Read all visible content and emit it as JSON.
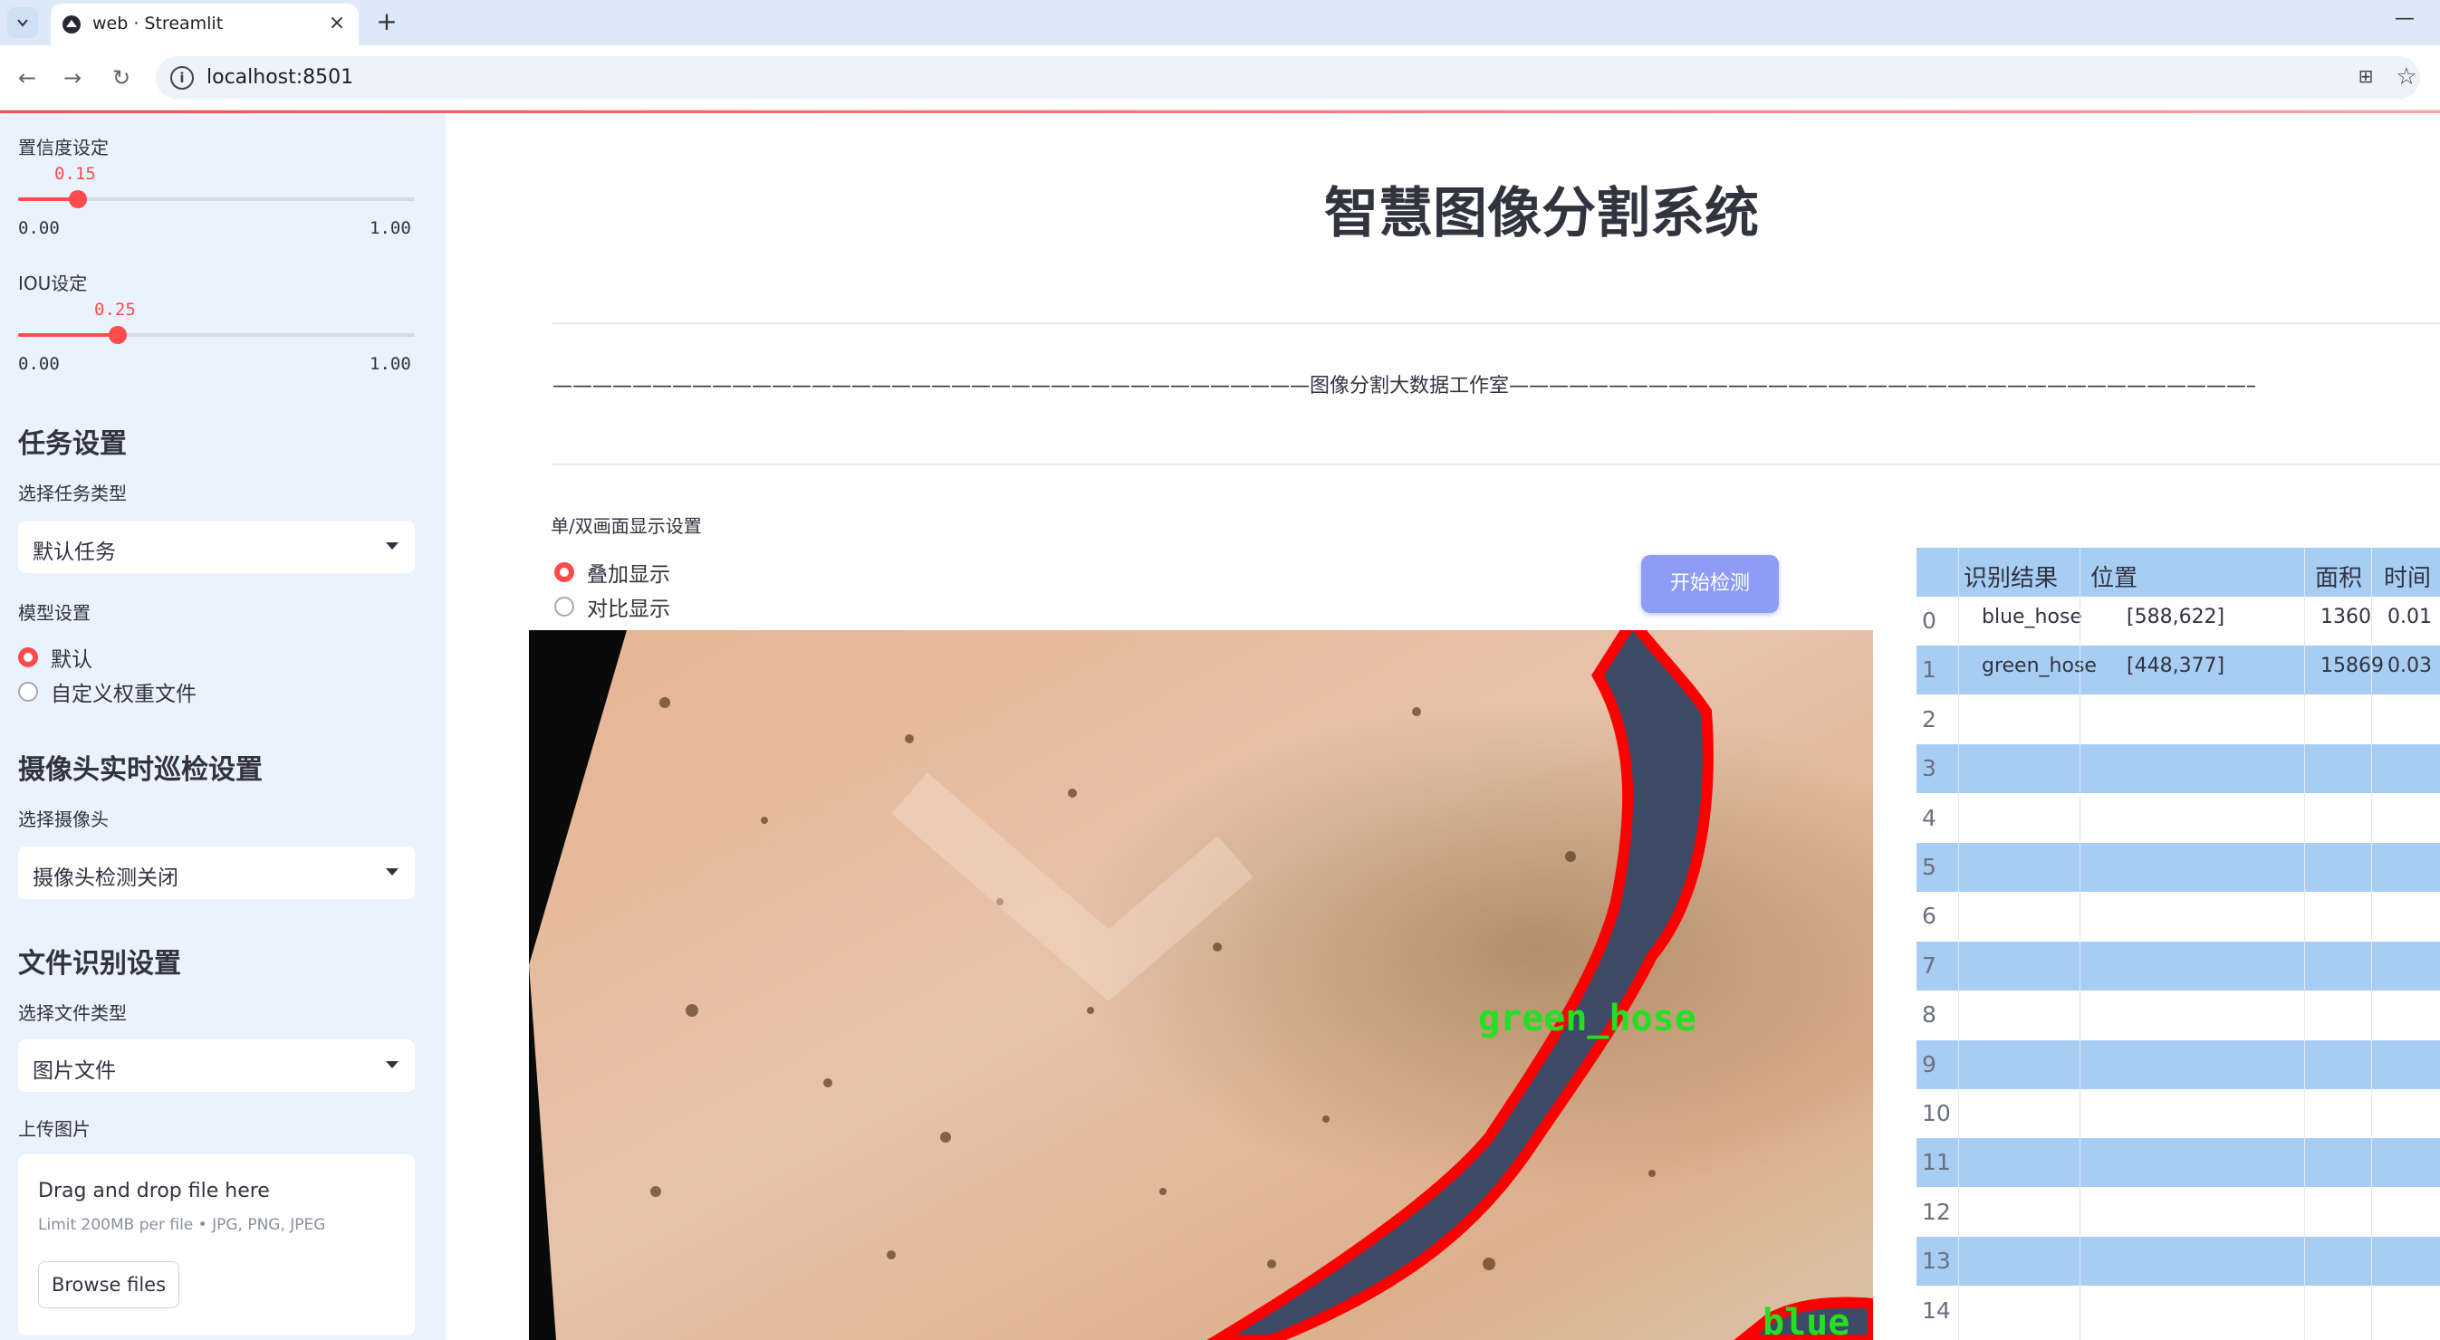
{
  "browser": {
    "tab_title": "web · Streamlit",
    "tab_close": "×",
    "new_tab": "+",
    "minimize": "—",
    "url": "localhost:8501",
    "back": "←",
    "forward": "→",
    "reload": "↻",
    "info": "i",
    "translate": "⊞",
    "star": "☆"
  },
  "sidebar": {
    "confidence": {
      "label": "置信度设定",
      "value": 0.15,
      "value_text": "0.15",
      "min": "0.00",
      "max": "1.00"
    },
    "iou": {
      "label": "IOU设定",
      "value": 0.25,
      "value_text": "0.25",
      "min": "0.00",
      "max": "1.00"
    },
    "task_heading": "任务设置",
    "task_type_label": "选择任务类型",
    "task_type_value": "默认任务",
    "model_label": "模型设置",
    "model_options": [
      "默认",
      "自定义权重文件"
    ],
    "model_selected": 0,
    "camera_heading": "摄像头实时巡检设置",
    "camera_label": "选择摄像头",
    "camera_value": "摄像头检测关闭",
    "file_heading": "文件识别设置",
    "file_type_label": "选择文件类型",
    "file_type_value": "图片文件",
    "upload_label": "上传图片",
    "upload_title": "Drag and drop file here",
    "upload_sub": "Limit 200MB per file • JPG, PNG, JPEG",
    "upload_button": "Browse files"
  },
  "main": {
    "title": "智慧图像分割系统",
    "banner": "——————————————————————————————————————图像分割大数据工作室——————————————————————————————————————",
    "display_label": "单/双画面显示设置",
    "display_options": [
      "叠加显示",
      "对比显示"
    ],
    "display_selected": 0,
    "start_button": "开始检测",
    "overlay_labels": [
      "green_hose",
      "blue"
    ]
  },
  "table": {
    "columns": [
      "识别结果",
      "位置",
      "面积",
      "时间"
    ],
    "rows": [
      {
        "idx": "0",
        "result": "blue_hose",
        "pos": "[588,622]",
        "area": "1360",
        "time": "0.01"
      },
      {
        "idx": "1",
        "result": "green_hose",
        "pos": "[448,377]",
        "area": "15869",
        "time": "0.03"
      },
      {
        "idx": "2"
      },
      {
        "idx": "3"
      },
      {
        "idx": "4"
      },
      {
        "idx": "5"
      },
      {
        "idx": "6"
      },
      {
        "idx": "7"
      },
      {
        "idx": "8"
      },
      {
        "idx": "9"
      },
      {
        "idx": "10"
      },
      {
        "idx": "11"
      },
      {
        "idx": "12"
      },
      {
        "idx": "13"
      },
      {
        "idx": "14"
      }
    ]
  },
  "colors": {
    "accent": "#ff4b4b",
    "sidebar_bg": "#eaf2fd",
    "table_stripe": "#a8cdf3",
    "button": "#8e9cf5",
    "mask_outline": "#ff0000",
    "label_green": "#22e022"
  }
}
